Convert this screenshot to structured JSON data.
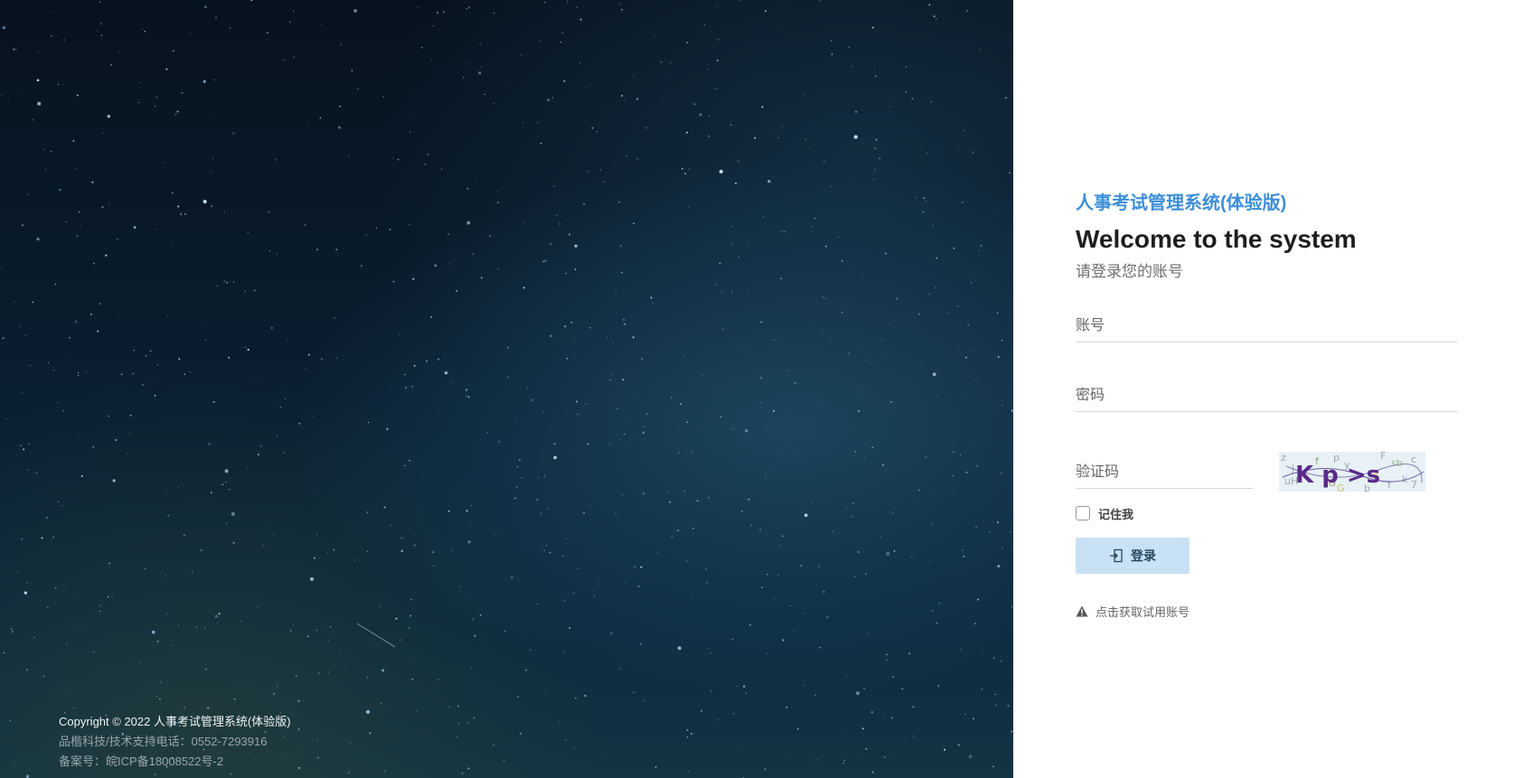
{
  "footer": {
    "copyright": "Copyright © 2022 人事考试管理系统(体验版)",
    "support": "品楷科技/技术支持电话：0552-7293916",
    "icp": "备案号：皖ICP备18008522号-2"
  },
  "login": {
    "system_title": "人事考试管理系统(体验版)",
    "welcome": "Welcome to the system",
    "subtitle": "请登录您的账号",
    "account_placeholder": "账号",
    "password_placeholder": "密码",
    "captcha_placeholder": "验证码",
    "captcha_text": "K p >s",
    "remember_label": "记住我",
    "remember_checked": false,
    "login_label": "登录",
    "trial_link": "点击获取试用账号"
  },
  "colors": {
    "accent": "#3d8fd8",
    "button_bg": "#c9e1f4"
  },
  "icons": {
    "login_button": "sign-in-icon",
    "trial": "warning-icon"
  }
}
